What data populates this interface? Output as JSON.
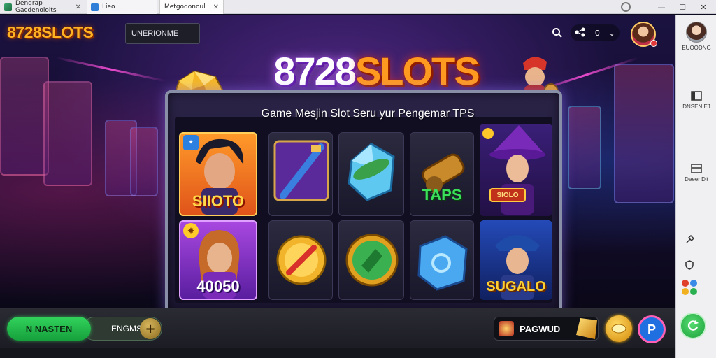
{
  "browser": {
    "tabs": [
      {
        "label": "Dengrap Gacdenololts",
        "close": "✕"
      },
      {
        "label": "Lieo",
        "close": ""
      },
      {
        "label": "Metgodonoul",
        "close": "✕"
      }
    ],
    "window_controls": {
      "minimize": "—",
      "maximize": "☐",
      "close": "✕"
    }
  },
  "header": {
    "logo": "8728SLOTS",
    "search_value": "UNERIONME",
    "count": "0",
    "search_icon": "search-icon",
    "share_icon": "network-icon",
    "chevron": "⌄"
  },
  "hero": {
    "title_number": "8728",
    "title_word": "SLOTS",
    "subtitle": "Game Mesjin Slot Seru yur Pengemar TPS"
  },
  "cards": {
    "top_left_label": "SIIOTO",
    "bottom_left_label": "40050",
    "middle_right_label": "TAPS",
    "right_top_label": "SIOLO",
    "right_bottom_label": "SUGALO"
  },
  "bottom_bar": {
    "play_label": "N NASTEN",
    "bet_label": "ENGMS",
    "plus": "+",
    "promo_label": "PAGWUD",
    "pay_label": "P"
  },
  "sidebar": {
    "profile_label": "EUOODNG",
    "item1_label": "DNSEN EJ",
    "item2_label": "Deeer Dit"
  },
  "colors": {
    "accent_green": "#22b84a",
    "accent_gold": "#ffb323",
    "accent_purple": "#7a2fd0",
    "title_orange": "#ff9a20"
  }
}
